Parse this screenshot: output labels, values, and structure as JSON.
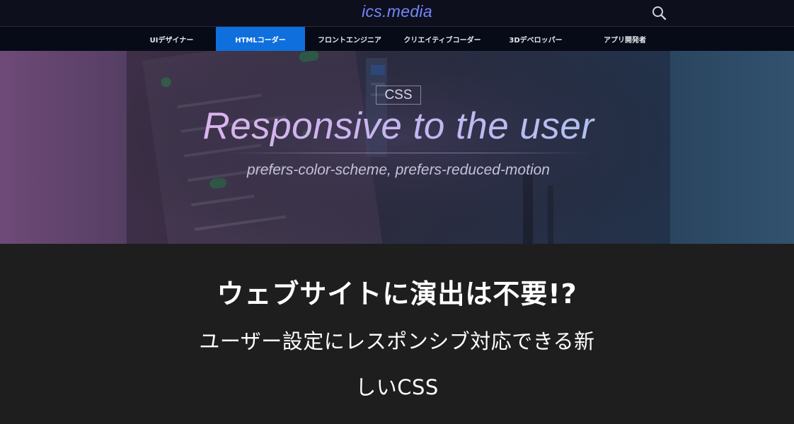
{
  "header": {
    "logo_text": "ics.media",
    "search_icon": "search-icon"
  },
  "nav": {
    "items": [
      {
        "label": "UIデザイナー",
        "active": false
      },
      {
        "label": "HTMLコーダー",
        "active": true
      },
      {
        "label": "フロントエンジニア",
        "active": false
      },
      {
        "label": "クリエイティブコーダー",
        "active": false
      },
      {
        "label": "3Dデベロッパー",
        "active": false
      },
      {
        "label": "アプリ開発者",
        "active": false
      }
    ]
  },
  "hero": {
    "tag": "CSS",
    "title": "Responsive to the user",
    "subtitle": "prefers-color-scheme, prefers-reduced-motion"
  },
  "article": {
    "title_line1": "ウェブサイトに演出は不要!?",
    "title_line2": "ユーザー設定にレスポンシブ対応できる新",
    "title_line3": "しいCSS"
  },
  "colors": {
    "header_bg": "#0d0f1c",
    "nav_bg": "#070a17",
    "nav_active": "#0f6fdd",
    "article_bg": "#1e1e1e",
    "logo_accent": "#8b6cff"
  }
}
